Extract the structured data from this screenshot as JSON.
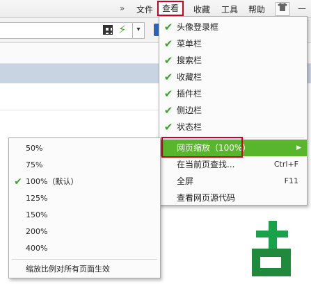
{
  "menubar": {
    "overflow_icon": "double-chevron-icon",
    "items": [
      {
        "label": "文件"
      },
      {
        "label": "查看"
      },
      {
        "label": "收藏"
      },
      {
        "label": "工具"
      },
      {
        "label": "帮助"
      }
    ],
    "skin_icon": "shirt-icon",
    "minimize_icon": "minimize-icon"
  },
  "view_menu": {
    "toggles": [
      {
        "label": "头像登录框",
        "checked": true
      },
      {
        "label": "菜单栏",
        "checked": true
      },
      {
        "label": "搜索栏",
        "checked": true
      },
      {
        "label": "收藏栏",
        "checked": true
      },
      {
        "label": "插件栏",
        "checked": true
      },
      {
        "label": "侧边栏",
        "checked": true
      },
      {
        "label": "状态栏",
        "checked": true
      }
    ],
    "zoom_item": {
      "label": "网页缩放（100%）",
      "submenu_icon": "triangle-right-icon"
    },
    "find_item": {
      "label": "在当前页查找...",
      "shortcut": "Ctrl+F"
    },
    "fullscreen_item": {
      "label": "全屏",
      "shortcut": "F11"
    },
    "source_item": {
      "label": "查看网页源代码"
    }
  },
  "zoom_submenu": {
    "options": [
      {
        "label": "50%",
        "checked": false
      },
      {
        "label": "75%",
        "checked": false
      },
      {
        "label": "100%（默认）",
        "checked": true
      },
      {
        "label": "125%",
        "checked": false
      },
      {
        "label": "150%",
        "checked": false
      },
      {
        "label": "200%",
        "checked": false
      },
      {
        "label": "400%",
        "checked": false
      }
    ],
    "apply_all_label": "缩放比例对所有页面生效"
  },
  "colors": {
    "highlight": "#58b52c",
    "check": "#3aa427",
    "annotation": "#d0021b"
  },
  "check_glyph": "✔",
  "arrow_glyph": "▶"
}
